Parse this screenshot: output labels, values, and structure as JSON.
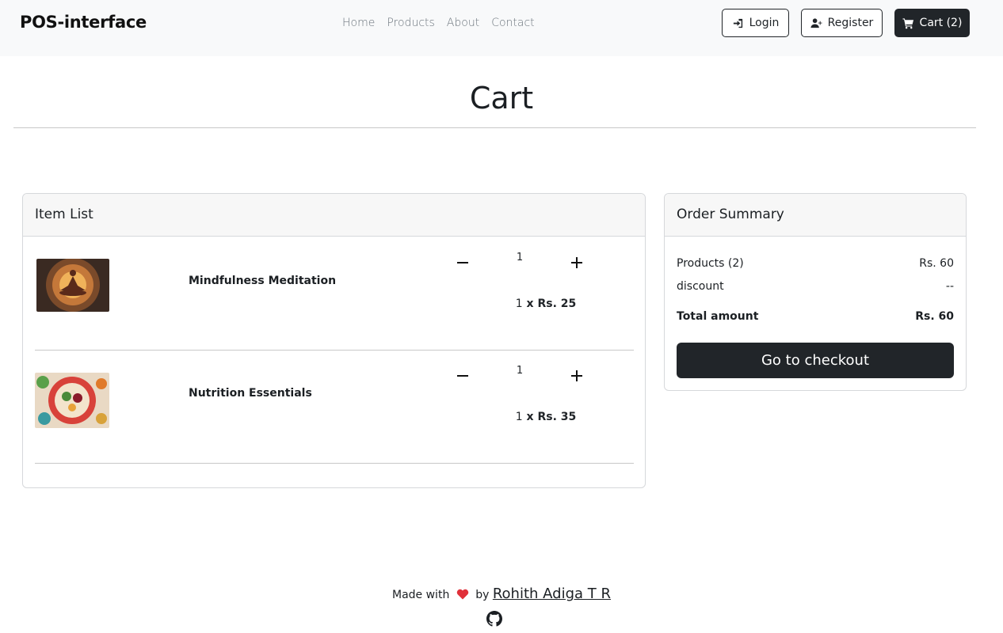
{
  "navbar": {
    "brand": "POS-interface",
    "links": [
      "Home",
      "Products",
      "About",
      "Contact"
    ],
    "login_label": "Login",
    "register_label": "Register",
    "cart_label": "Cart (2)"
  },
  "page": {
    "title": "Cart"
  },
  "item_list": {
    "header": "Item List",
    "items": [
      {
        "name": "Mindfulness Meditation",
        "quantity": "1",
        "qty_prefix": "1",
        "price_text": " x Rs. 25"
      },
      {
        "name": "Nutrition Essentials",
        "quantity": "1",
        "qty_prefix": "1",
        "price_text": " x Rs. 35"
      }
    ]
  },
  "summary": {
    "header": "Order Summary",
    "products_label": "Products (2)",
    "products_value": "Rs. 60",
    "discount_label": "discount",
    "discount_value": "--",
    "total_label": "Total amount",
    "total_value": "Rs. 60",
    "checkout_label": "Go to checkout"
  },
  "footer": {
    "made_with": "Made with",
    "by": "by",
    "author": "Rohith Adiga T R"
  },
  "colors": {
    "dark": "#212529",
    "navbar_bg": "#f8f9fa",
    "heart": "#e0303a"
  }
}
